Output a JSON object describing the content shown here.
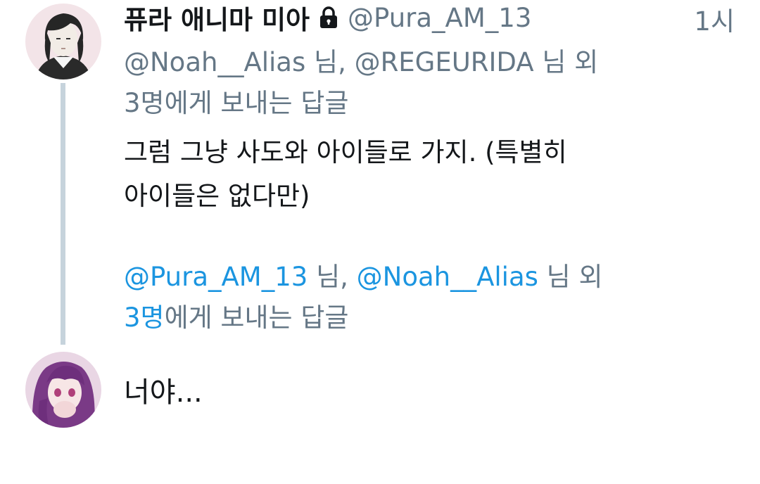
{
  "tweet": {
    "display_name": "퓨라 애니마 미아",
    "handle": "@Pura_AM_13",
    "timestamp": "1시",
    "protected_icon": "lock-icon",
    "replying_to": {
      "mention_1": "@Noah__Alias",
      "suffix_1": " 님, ",
      "mention_2": "@REGEURIDA",
      "suffix_2": " 님 외",
      "others": "3명",
      "tail": "에게 보내는 답글"
    },
    "text_line_1": "그럼 그냥 사도와 아이들로 가지. (특별히",
    "text_line_2": "아이들은 없다만)"
  },
  "reply": {
    "replying_to": {
      "mention_1": "@Pura_AM_13",
      "suffix_1": " 님, ",
      "mention_2": "@Noah__Alias",
      "suffix_2": " 님 외",
      "others": "3명",
      "tail": "에게 보내는 답글"
    },
    "text": "너야..."
  },
  "colors": {
    "primary_text": "#14171a",
    "secondary_text": "#657786",
    "link": "#1b95e0",
    "thread_line": "#c6d3dc"
  }
}
